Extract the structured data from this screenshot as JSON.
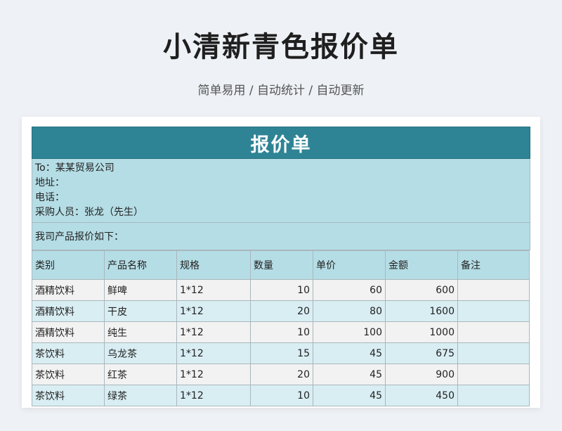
{
  "header": {
    "title": "小清新青色报价单",
    "subtitle": "简单易用  /  自动统计  /  自动更新"
  },
  "sheet": {
    "title": "报价单",
    "info": {
      "to": "To：某某贸易公司",
      "address": "地址：",
      "phone": "电话：",
      "buyer": "采购人员：张龙（先生）"
    },
    "intro": "我司产品报价如下：",
    "columns": [
      "类别",
      "产品名称",
      "规格",
      "数量",
      "单价",
      "金额",
      "备注"
    ],
    "rows": [
      {
        "category": "酒精饮料",
        "name": "鲜啤",
        "spec": "1*12",
        "qty": "10",
        "price": "60",
        "amount": "600",
        "note": ""
      },
      {
        "category": "酒精饮料",
        "name": "干皮",
        "spec": "1*12",
        "qty": "20",
        "price": "80",
        "amount": "1600",
        "note": ""
      },
      {
        "category": "酒精饮料",
        "name": "纯生",
        "spec": "1*12",
        "qty": "10",
        "price": "100",
        "amount": "1000",
        "note": ""
      },
      {
        "category": "茶饮料",
        "name": "乌龙茶",
        "spec": "1*12",
        "qty": "15",
        "price": "45",
        "amount": "675",
        "note": ""
      },
      {
        "category": "茶饮料",
        "name": "红茶",
        "spec": "1*12",
        "qty": "20",
        "price": "45",
        "amount": "900",
        "note": ""
      },
      {
        "category": "茶饮料",
        "name": "绿茶",
        "spec": "1*12",
        "qty": "10",
        "price": "45",
        "amount": "450",
        "note": ""
      }
    ]
  }
}
